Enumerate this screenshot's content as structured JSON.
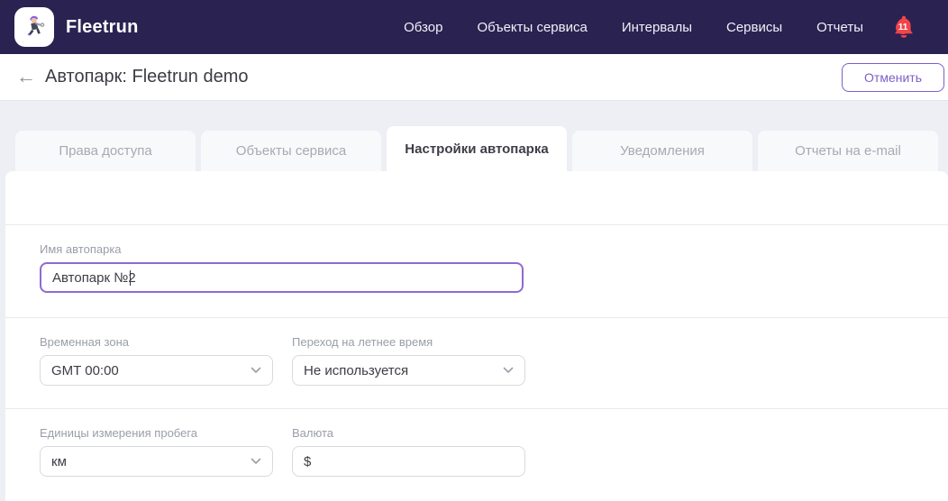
{
  "brand": {
    "name": "Fleetrun"
  },
  "navbar": {
    "items": [
      {
        "label": "Обзор"
      },
      {
        "label": "Объекты сервиса"
      },
      {
        "label": "Интервалы"
      },
      {
        "label": "Сервисы"
      },
      {
        "label": "Отчеты"
      }
    ],
    "notifications": {
      "count": "11"
    }
  },
  "header": {
    "title": "Автопарк: Fleetrun demo",
    "cancel_label": "Отменить"
  },
  "tabs": [
    {
      "label": "Права доступа"
    },
    {
      "label": "Объекты сервиса"
    },
    {
      "label": "Настройки автопарка"
    },
    {
      "label": "Уведомления"
    },
    {
      "label": "Отчеты на e-mail"
    }
  ],
  "form": {
    "fleet_name": {
      "label": "Имя автопарка",
      "value": "Автопарк №2"
    },
    "timezone": {
      "label": "Временная зона",
      "value": "GMT 00:00"
    },
    "dst": {
      "label": "Переход на летнее время",
      "value": "Не используется"
    },
    "mileage_units": {
      "label": "Единицы измерения пробега",
      "value": "км"
    },
    "currency": {
      "label": "Валюта",
      "value": "$"
    }
  },
  "colors": {
    "navbar_bg": "#2a2251",
    "accent_purple": "#7d5fc8",
    "focus_border": "#8f6ad2",
    "notification_red": "#f2444b",
    "page_bg": "#edeff4"
  }
}
